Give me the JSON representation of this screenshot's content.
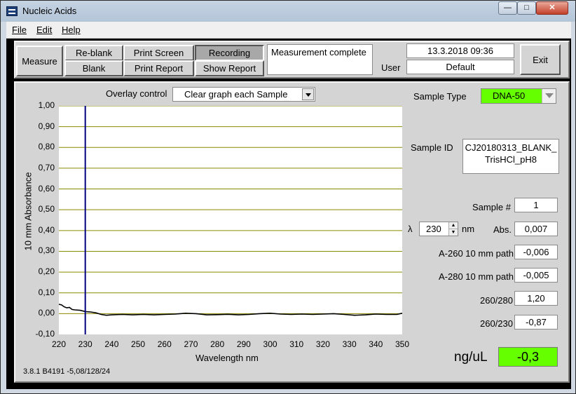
{
  "window": {
    "title": "Nucleic Acids"
  },
  "menu": {
    "file": "File",
    "edit": "Edit",
    "help": "Help"
  },
  "toolbar": {
    "measure": "Measure",
    "reblank": "Re-blank",
    "blank": "Blank",
    "print_screen": "Print Screen",
    "print_report": "Print Report",
    "recording": "Recording",
    "show_report": "Show Report",
    "status": "Measurement complete",
    "datetime": "13.3.2018  09:36",
    "user_label": "User",
    "user": "Default",
    "exit": "Exit"
  },
  "overlay": {
    "label": "Overlay control",
    "value": "Clear graph each Sample"
  },
  "sample": {
    "type_label": "Sample Type",
    "type_value": "DNA-50",
    "id_label": "Sample ID",
    "id_line1": "CJ20180313_BLANK_",
    "id_line2": "TrisHCl_pH8",
    "number_label": "Sample #",
    "number_value": "1",
    "lambda_symbol": "λ",
    "lambda_value": "230",
    "lambda_unit": "nm",
    "abs_label": "Abs.",
    "abs_value": "0,007",
    "a260_label": "A-260 10 mm path",
    "a260_value": "-0,006",
    "a280_label": "A-280 10 mm path",
    "a280_value": "-0,005",
    "r260_280_label": "260/280",
    "r260_280_value": "1,20",
    "r260_230_label": "260/230",
    "r260_230_value": "-0,87",
    "conc_label": "ng/uL",
    "conc_value": "-0,3"
  },
  "footer": {
    "version": "3.8.1 B4191 -5,08/128/24"
  },
  "colors": {
    "type_badge": "#66ff00",
    "conc_badge": "#66ff00",
    "grid": "#8a8a00",
    "cursor": "#000080",
    "trace": "#000000"
  },
  "chart_data": {
    "type": "line",
    "xlabel": "Wavelength nm",
    "ylabel": "10 mm Absorbance",
    "xlim": [
      220,
      350
    ],
    "ylim": [
      -0.1,
      1.0
    ],
    "x_ticks": [
      "220",
      "230",
      "240",
      "250",
      "260",
      "270",
      "280",
      "290",
      "300",
      "310",
      "320",
      "330",
      "340",
      "350"
    ],
    "y_ticks": [
      "1,00",
      "0,90",
      "0,80",
      "0,70",
      "0,60",
      "0,50",
      "0,40",
      "0,30",
      "0,20",
      "0,10",
      "0,00",
      "-0,10"
    ],
    "grid": "horizontal",
    "cursor_x": 230,
    "series": [
      {
        "x": [
          220,
          221,
          222,
          223,
          224,
          225,
          226,
          228,
          230,
          232,
          234,
          236,
          238,
          240,
          244,
          248,
          252,
          256,
          260,
          264,
          268,
          272,
          276,
          280,
          284,
          288,
          292,
          296,
          300,
          304,
          308,
          312,
          316,
          320,
          324,
          328,
          332,
          336,
          340,
          344,
          348,
          350
        ],
        "y": [
          0.045,
          0.042,
          0.033,
          0.028,
          0.03,
          0.02,
          0.018,
          0.016,
          0.01,
          0.008,
          0.004,
          -0.004,
          -0.008,
          -0.006,
          -0.004,
          -0.006,
          -0.004,
          -0.006,
          -0.004,
          -0.002,
          0.002,
          0.0,
          -0.006,
          -0.005,
          -0.003,
          -0.006,
          -0.004,
          0.0,
          0.002,
          -0.002,
          -0.004,
          -0.002,
          -0.004,
          -0.002,
          0.0,
          -0.004,
          -0.008,
          -0.006,
          -0.002,
          -0.004,
          -0.004,
          0.002
        ]
      }
    ]
  }
}
